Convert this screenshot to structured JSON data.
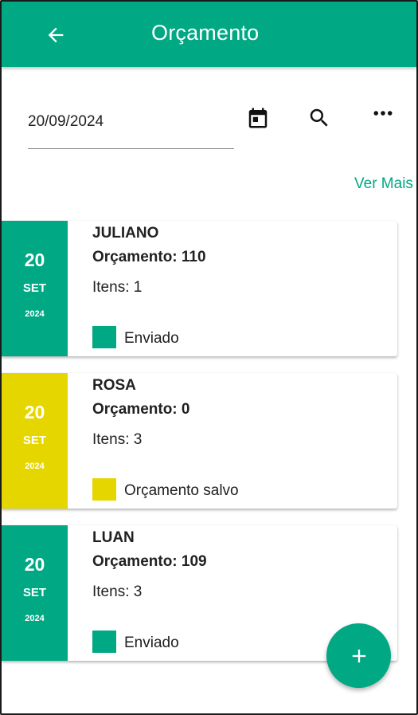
{
  "app_bar": {
    "title": "Orçamento",
    "back_icon": "arrow-back-icon",
    "color": "#00a884"
  },
  "filter": {
    "date_value": "20/09/2024",
    "calendar_icon": "calendar-icon",
    "search_icon": "search-icon",
    "more_icon": "more-horiz-icon"
  },
  "ver_mais_label": "Ver Mais",
  "cards": [
    {
      "day": "20",
      "month": "SET",
      "year": "2024",
      "name": "JULIANO",
      "budget": "Orçamento: 110",
      "items": "Itens: 1",
      "status": "Enviado",
      "color": "#00a884"
    },
    {
      "day": "20",
      "month": "SET",
      "year": "2024",
      "name": "ROSA",
      "budget": "Orçamento: 0",
      "items": "Itens: 3",
      "status": "Orçamento salvo",
      "color": "#e6d600"
    },
    {
      "day": "20",
      "month": "SET",
      "year": "2024",
      "name": "LUAN",
      "budget": "Orçamento: 109",
      "items": "Itens: 3",
      "status": "Enviado",
      "color": "#00a884"
    }
  ],
  "fab": {
    "icon": "add-icon",
    "color": "#00a884"
  }
}
